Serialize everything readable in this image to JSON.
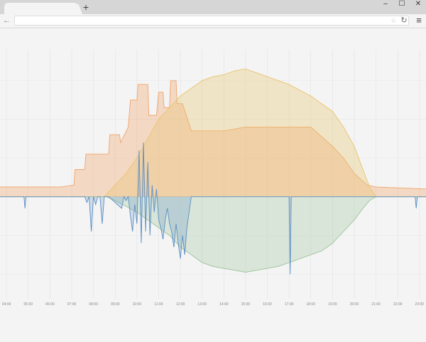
{
  "browser": {
    "tab_title": "",
    "new_tab_label": "+",
    "url": "",
    "controls": {
      "minimize": "–",
      "maximize": "☐",
      "close": "✕"
    },
    "icons": {
      "back": "back-arrow-icon",
      "star": "bookmark-star-icon",
      "reload": "reload-icon",
      "menu": "hamburger-menu-icon"
    }
  },
  "chart_data": {
    "type": "area",
    "x_ticks": [
      "04:00",
      "05:00",
      "06:00",
      "07:00",
      "08:00",
      "09:00",
      "10:00",
      "11:00",
      "12:00",
      "13:00",
      "14:00",
      "15:00",
      "16:00",
      "17:00",
      "18:00",
      "19:00",
      "20:00",
      "21:00",
      "22:00",
      "23:00"
    ],
    "xlim": [
      3.7,
      23.3
    ],
    "ylim": [
      -2600,
      3800
    ],
    "grid": true,
    "legend": "none",
    "series": [
      {
        "color": "#f0a46a",
        "x": [
          3.7,
          6.5,
          7.1,
          7.15,
          7.6,
          7.65,
          8.7,
          8.75,
          9.2,
          9.25,
          9.6,
          9.7,
          10.0,
          10.05,
          10.5,
          10.55,
          10.9,
          11.0,
          11.2,
          11.25,
          11.5,
          11.55,
          11.8,
          11.85,
          12.1,
          12.5,
          13,
          14,
          15,
          16,
          17,
          18,
          19,
          19.5,
          20,
          20.3,
          20.6,
          21,
          23.3
        ],
        "values": [
          250,
          250,
          300,
          700,
          700,
          1100,
          1100,
          1600,
          1600,
          1400,
          1800,
          2500,
          2500,
          2900,
          2900,
          2100,
          2100,
          2700,
          2700,
          2300,
          2300,
          3000,
          3000,
          2400,
          2400,
          1700,
          1700,
          1700,
          1800,
          1800,
          1800,
          1800,
          1300,
          1000,
          600,
          450,
          300,
          250,
          200
        ]
      },
      {
        "color": "#e8c46a",
        "x": [
          3.7,
          8.5,
          9,
          9.5,
          10,
          10.5,
          11,
          11.5,
          12,
          12.5,
          13,
          13.5,
          14,
          14.5,
          15,
          15.5,
          16,
          16.5,
          17,
          17.5,
          18,
          18.5,
          19,
          19.5,
          20,
          20.4,
          20.7,
          21,
          23.3
        ],
        "values": [
          0,
          0,
          300,
          600,
          1000,
          1500,
          2000,
          2300,
          2600,
          2800,
          3000,
          3100,
          3150,
          3250,
          3300,
          3200,
          3100,
          3000,
          2900,
          2750,
          2600,
          2400,
          2200,
          1800,
          1300,
          700,
          250,
          0,
          0
        ]
      },
      {
        "color": "#9dc49a",
        "x": [
          3.7,
          8.6,
          9,
          9.5,
          10,
          10.5,
          11,
          11.5,
          12,
          12.5,
          13,
          13.5,
          14,
          14.5,
          15,
          15.5,
          16,
          16.5,
          17,
          17.5,
          18,
          18.5,
          19,
          19.5,
          20,
          20.4,
          20.7,
          21,
          23.3
        ],
        "values": [
          0,
          0,
          -100,
          -250,
          -400,
          -600,
          -800,
          -1000,
          -1300,
          -1500,
          -1700,
          -1800,
          -1850,
          -1900,
          -1950,
          -1900,
          -1850,
          -1800,
          -1700,
          -1600,
          -1500,
          -1400,
          -1200,
          -900,
          -600,
          -300,
          -100,
          0,
          0
        ]
      },
      {
        "color": "#5b8ec4",
        "x": [
          3.7,
          4.8,
          4.85,
          4.9,
          7.6,
          7.7,
          7.8,
          7.9,
          8.0,
          8.1,
          8.2,
          8.3,
          8.4,
          8.5,
          8.6,
          8.7,
          9.3,
          9.4,
          9.5,
          9.6,
          9.7,
          9.8,
          9.9,
          10.0,
          10.1,
          10.2,
          10.3,
          10.4,
          10.5,
          10.6,
          10.7,
          10.8,
          10.9,
          11.0,
          11.1,
          11.2,
          11.3,
          11.4,
          11.5,
          11.6,
          11.7,
          11.8,
          11.9,
          12.0,
          12.1,
          12.2,
          12.3,
          12.4,
          12.5,
          17.0,
          17.05,
          17.1,
          22.8,
          22.85,
          22.9,
          23.3
        ],
        "values": [
          0,
          0,
          -300,
          0,
          0,
          -150,
          0,
          -900,
          0,
          -200,
          0,
          0,
          -700,
          0,
          0,
          0,
          -300,
          0,
          -100,
          0,
          -500,
          -900,
          -200,
          -700,
          1200,
          -1200,
          1400,
          -900,
          900,
          -1000,
          300,
          -400,
          200,
          -600,
          -800,
          -1100,
          -600,
          -300,
          -700,
          -900,
          -1300,
          -700,
          -1200,
          -1600,
          -1000,
          -1500,
          -800,
          -400,
          0,
          0,
          -2000,
          0,
          0,
          -300,
          0,
          0
        ]
      }
    ]
  }
}
